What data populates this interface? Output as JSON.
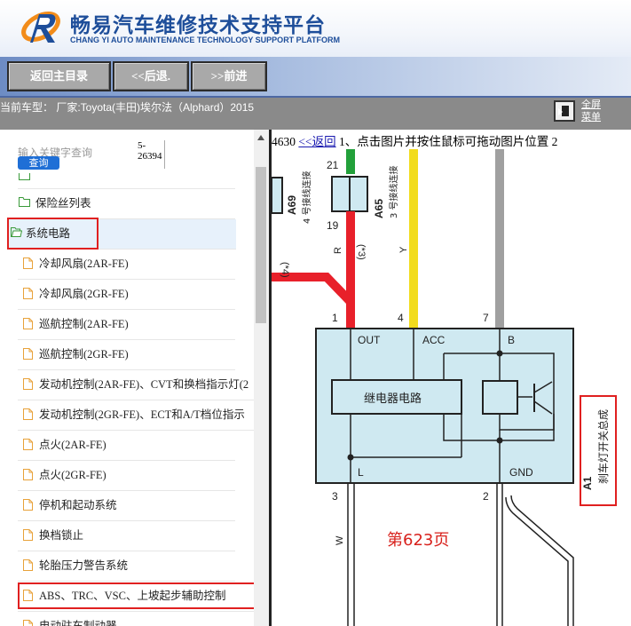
{
  "header": {
    "title_cn": "畅易汽车维修技术支持平台",
    "title_en": "CHANG YI AUTO MAINTENANCE TECHNOLOGY SUPPORT PLATFORM",
    "logo_icon": "swoosh-logo-icon"
  },
  "nav": {
    "home": "返回主目录",
    "back": "<<后退.",
    "forward": ">>前进"
  },
  "info": {
    "current_model": "当前车型： 厂家:Toyota(丰田)埃尔法（Alphard）2015",
    "fullscreen_line1": "全屏",
    "fullscreen_line2": "菜单"
  },
  "search": {
    "placeholder": "输入关键字查询",
    "button": "查询",
    "count_line1": "5-",
    "count_line2": "26394"
  },
  "tree": {
    "items": [
      {
        "label": "保险丝列表",
        "type": "folder"
      },
      {
        "label": "系统电路",
        "type": "folder-open"
      },
      {
        "label": "冷却风扇(2AR-FE)",
        "type": "doc"
      },
      {
        "label": "冷却风扇(2GR-FE)",
        "type": "doc"
      },
      {
        "label": "巡航控制(2AR-FE)",
        "type": "doc"
      },
      {
        "label": "巡航控制(2GR-FE)",
        "type": "doc"
      },
      {
        "label": "发动机控制(2AR-FE)、CVT和换档指示灯(2",
        "type": "doc"
      },
      {
        "label": "发动机控制(2GR-FE)、ECT和A/T档位指示",
        "type": "doc"
      },
      {
        "label": "点火(2AR-FE)",
        "type": "doc"
      },
      {
        "label": "点火(2GR-FE)",
        "type": "doc"
      },
      {
        "label": "停机和起动系统",
        "type": "doc"
      },
      {
        "label": "换档锁止",
        "type": "doc"
      },
      {
        "label": "轮胎压力警告系统",
        "type": "doc"
      },
      {
        "label": "ABS、TRC、VSC、上坡起步辅助控制",
        "type": "doc"
      },
      {
        "label": "电动驻车制动器",
        "type": "doc"
      }
    ]
  },
  "diagram_head": {
    "number": "4630",
    "back_link": "<<返回",
    "instruction": " 1、点击图片并按住鼠标可拖动图片位置 2"
  },
  "diagram": {
    "pin_top_left": "21",
    "pin_19": "19",
    "conn_a69": "A69",
    "conn_a69_desc": "4 号接线连接",
    "conn_a65": "A65",
    "conn_a65_desc": "3 号接线连接",
    "note_4": "(*4)",
    "note_3": "(*3)",
    "wire_r": "R",
    "wire_y": "Y",
    "wire_w": "W",
    "pin1": "1",
    "pin4": "4",
    "pin7": "7",
    "pin3": "3",
    "pin2": "2",
    "term_out": "OUT",
    "term_acc": "ACC",
    "term_b": "B",
    "term_l": "L",
    "term_gnd": "GND",
    "relay_label": "继电器电路",
    "comp_code": "A1",
    "comp_name": "刹车灯开关总成",
    "page_label": "第623页",
    "colors": {
      "red": "#e8202a",
      "yellow": "#f2dc1c",
      "green": "#22a03a",
      "gray": "#a0a0a0",
      "box": "#cfe9f1"
    }
  }
}
